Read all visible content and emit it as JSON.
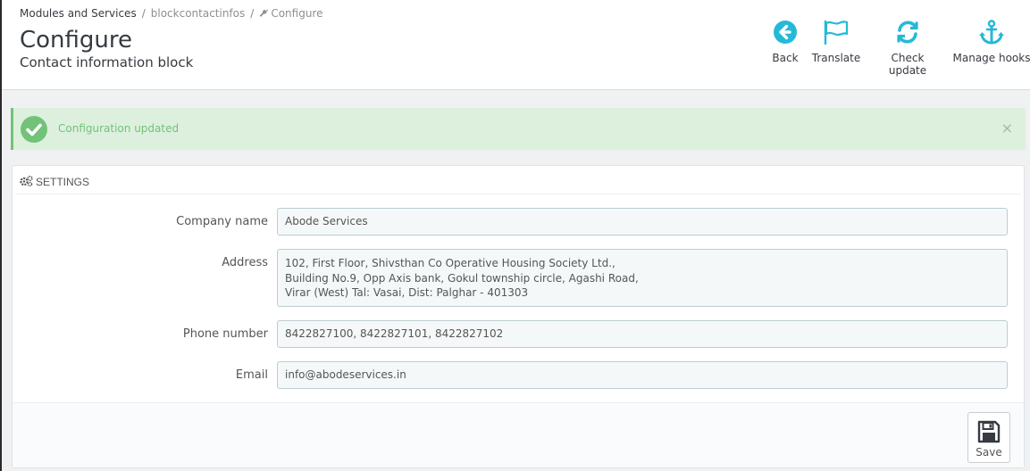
{
  "breadcrumb": {
    "items": [
      "Modules and Services",
      "blockcontactinfos",
      "Configure"
    ],
    "separator": "/"
  },
  "header": {
    "title": "Configure",
    "subtitle": "Contact information block"
  },
  "toolbar": {
    "buttons": [
      {
        "label": "Back",
        "icon": "back-arrow-circle-icon"
      },
      {
        "label": "Translate",
        "icon": "flag-icon"
      },
      {
        "label": "Check update",
        "icon": "refresh-icon"
      },
      {
        "label": "Manage hooks",
        "icon": "anchor-icon"
      }
    ],
    "accent_color": "#25b9d7"
  },
  "alert": {
    "message": "Configuration updated",
    "close": "×",
    "color": "#72c279"
  },
  "panel": {
    "heading": "SETTINGS",
    "fields": {
      "company": {
        "label": "Company name",
        "value": "Abode Services"
      },
      "address": {
        "label": "Address",
        "lines": [
          "102, First Floor, Shivsthan Co Operative Housing Society Ltd.,",
          "Building No.9, Opp Axis bank, Gokul township circle, Agashi Road,",
          "Virar (West) Tal: Vasai, Dist: Palghar - 401303"
        ]
      },
      "phone": {
        "label": "Phone number",
        "value": "8422827100, 8422827101, 8422827102"
      },
      "email": {
        "label": "Email",
        "value": "info@abodeservices.in"
      }
    },
    "save_label": "Save"
  }
}
